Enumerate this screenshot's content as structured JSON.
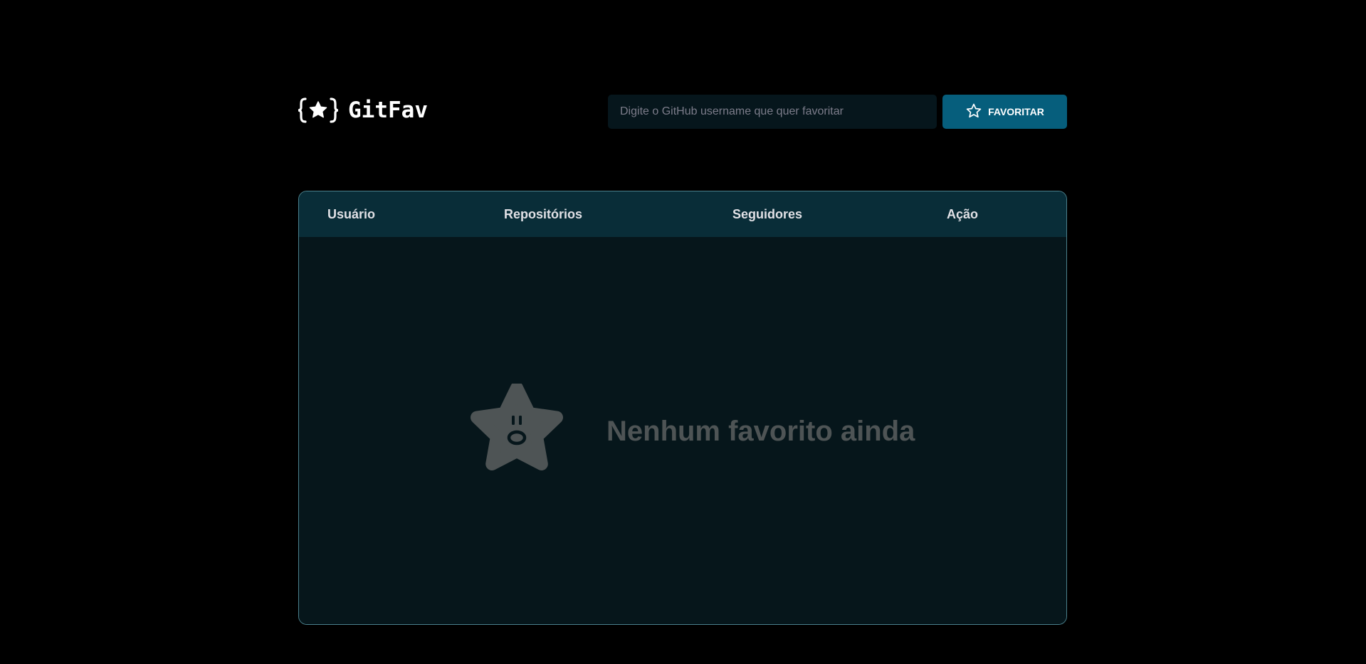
{
  "app": {
    "logo_text": "GitFav"
  },
  "search": {
    "placeholder": "Digite o GitHub username que quer favoritar",
    "value": "",
    "button_label": "FAVORITAR"
  },
  "table": {
    "columns": [
      "Usuário",
      "Repositórios",
      "Seguidores",
      "Ação"
    ],
    "rows": [],
    "empty_message": "Nenhum favorito ainda"
  },
  "icons": {
    "logo": "braces-star-icon",
    "favorite_button": "star-outline-icon",
    "empty_state": "surprised-star-icon"
  },
  "colors": {
    "background": "#000000",
    "accent": "#065e7c",
    "table_header": "#092d38",
    "table_body": "#06161b",
    "table_border": "#4a808c",
    "empty_text": "#4e5455"
  }
}
